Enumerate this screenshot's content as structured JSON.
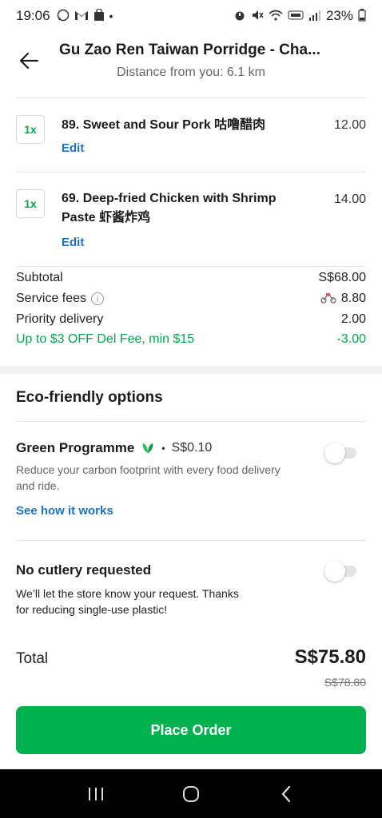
{
  "status_bar": {
    "time": "19:06",
    "battery": "23%"
  },
  "header": {
    "title": "Gu Zao Ren Taiwan Porridge - Cha...",
    "subtitle": "Distance from you: 6.1 km"
  },
  "items": [
    {
      "qty": "1x",
      "name": "89. Sweet and Sour Pork 咕噜醋肉",
      "price": "12.00",
      "edit_label": "Edit"
    },
    {
      "qty": "1x",
      "name": "69. Deep-fried Chicken with Shrimp Paste 虾酱炸鸡",
      "price": "14.00",
      "edit_label": "Edit"
    }
  ],
  "fees": {
    "subtotal_label": "Subtotal",
    "subtotal_value": "S$68.00",
    "service_label": "Service fees",
    "service_value": "8.80",
    "priority_label": "Priority delivery",
    "priority_value": "2.00",
    "promo_label": "Up to $3 OFF Del Fee, min $15",
    "promo_value": "-3.00"
  },
  "eco": {
    "section_title": "Eco-friendly options",
    "green_title": "Green Programme",
    "green_price": "S$0.10",
    "green_desc": "Reduce your carbon footprint with every food delivery and ride.",
    "green_link": "See how it works",
    "green_enabled": false,
    "cutlery_title": "No cutlery requested",
    "cutlery_desc": "We’ll let the store know your request. Thanks for reducing single-use plastic!",
    "cutlery_enabled": false
  },
  "total": {
    "label": "Total",
    "value": "S$75.80",
    "original": "S$78.80"
  },
  "place_order_label": "Place Order",
  "colors": {
    "brand_green": "#00b14f",
    "link_blue": "#1a73c7",
    "promo_green": "#00a94f"
  }
}
